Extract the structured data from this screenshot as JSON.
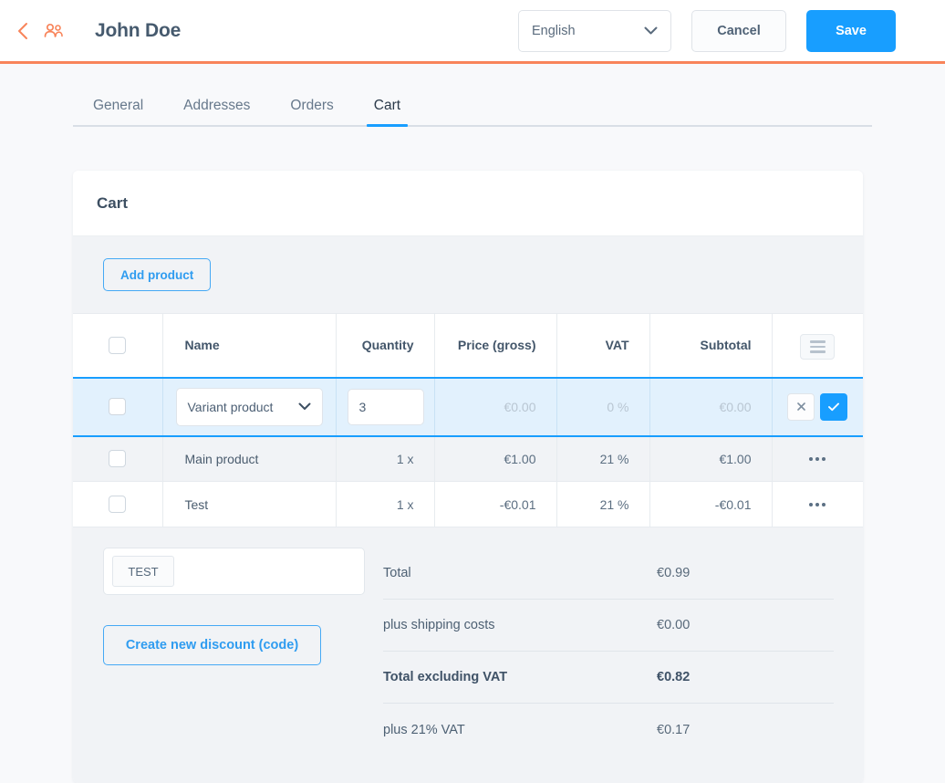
{
  "header": {
    "back_icon": "chevron-left-icon",
    "customers_icon": "people-icon",
    "title": "John Doe",
    "language": {
      "value": "English",
      "chevron": "chevron-down-icon"
    },
    "cancel_label": "Cancel",
    "save_label": "Save",
    "accent_color": "#f8845a"
  },
  "tabs": [
    {
      "label": "General",
      "active": false
    },
    {
      "label": "Addresses",
      "active": false
    },
    {
      "label": "Orders",
      "active": false
    },
    {
      "label": "Cart",
      "active": true
    }
  ],
  "card": {
    "title": "Cart",
    "add_product_label": "Add product",
    "settings_icon": "table-settings-icon"
  },
  "table": {
    "columns": [
      "",
      "Name",
      "Quantity",
      "Price (gross)",
      "VAT",
      "Subtotal",
      ""
    ],
    "edit_row": {
      "product_select": "Variant product",
      "select_chevron": "chevron-down-icon",
      "quantity": "3",
      "price": "€0.00",
      "vat": "0 %",
      "subtotal": "€0.00",
      "cancel_icon": "close-icon",
      "confirm_icon": "check-icon"
    },
    "rows": [
      {
        "name": "Main product",
        "quantity": "1 x",
        "price": "€1.00",
        "vat": "21 %",
        "subtotal": "€1.00",
        "menu_icon": "more-options-icon"
      },
      {
        "name": "Test",
        "quantity": "1 x",
        "price": "-€0.01",
        "vat": "21 %",
        "subtotal": "-€0.01",
        "menu_icon": "more-options-icon"
      }
    ]
  },
  "discount": {
    "chip": "TEST",
    "create_label": "Create new discount (code)"
  },
  "summary": [
    {
      "label": "Total",
      "value": "€0.99",
      "strong": false
    },
    {
      "label": "plus shipping costs",
      "value": "€0.00",
      "strong": false
    },
    {
      "label": "Total excluding VAT",
      "value": "€0.82",
      "strong": true
    },
    {
      "label": "plus 21% VAT",
      "value": "€0.17",
      "strong": false
    }
  ],
  "colors": {
    "accent_orange": "#f8845a",
    "primary_blue": "#189eff",
    "page_bg": "#f8f9fb",
    "panel_bg": "#f1f3f6",
    "edit_row_bg": "#e2f1fd"
  }
}
